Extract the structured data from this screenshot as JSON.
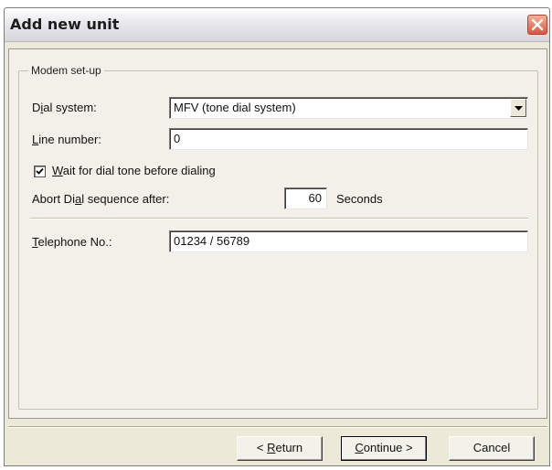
{
  "window": {
    "title": "Add new unit"
  },
  "modem_setup": {
    "legend": "Modem set-up",
    "dial_system": {
      "label_pre": "D",
      "label_key": "i",
      "label_post": "al system:",
      "value": "MFV (tone dial system)"
    },
    "line_number": {
      "label_key": "L",
      "label_post": "ine number:",
      "value": "0"
    },
    "wait_dial_tone": {
      "checked": true,
      "label_key": "W",
      "label_post": "ait for dial tone before dialing"
    },
    "abort_dial": {
      "label_pre": "Abort Di",
      "label_key": "a",
      "label_post": "l sequence after:",
      "value": "60",
      "unit": "Seconds"
    },
    "telephone": {
      "label_key": "T",
      "label_post": "elephone No.:",
      "value": "01234 / 56789"
    }
  },
  "buttons": {
    "return_pre": "< ",
    "return_key": "R",
    "return_post": "eturn",
    "continue_key": "C",
    "continue_post": "ontinue >",
    "cancel": "Cancel"
  },
  "colors": {
    "dialog_bg": "#ece9d8",
    "close_button": "#e0533a"
  }
}
